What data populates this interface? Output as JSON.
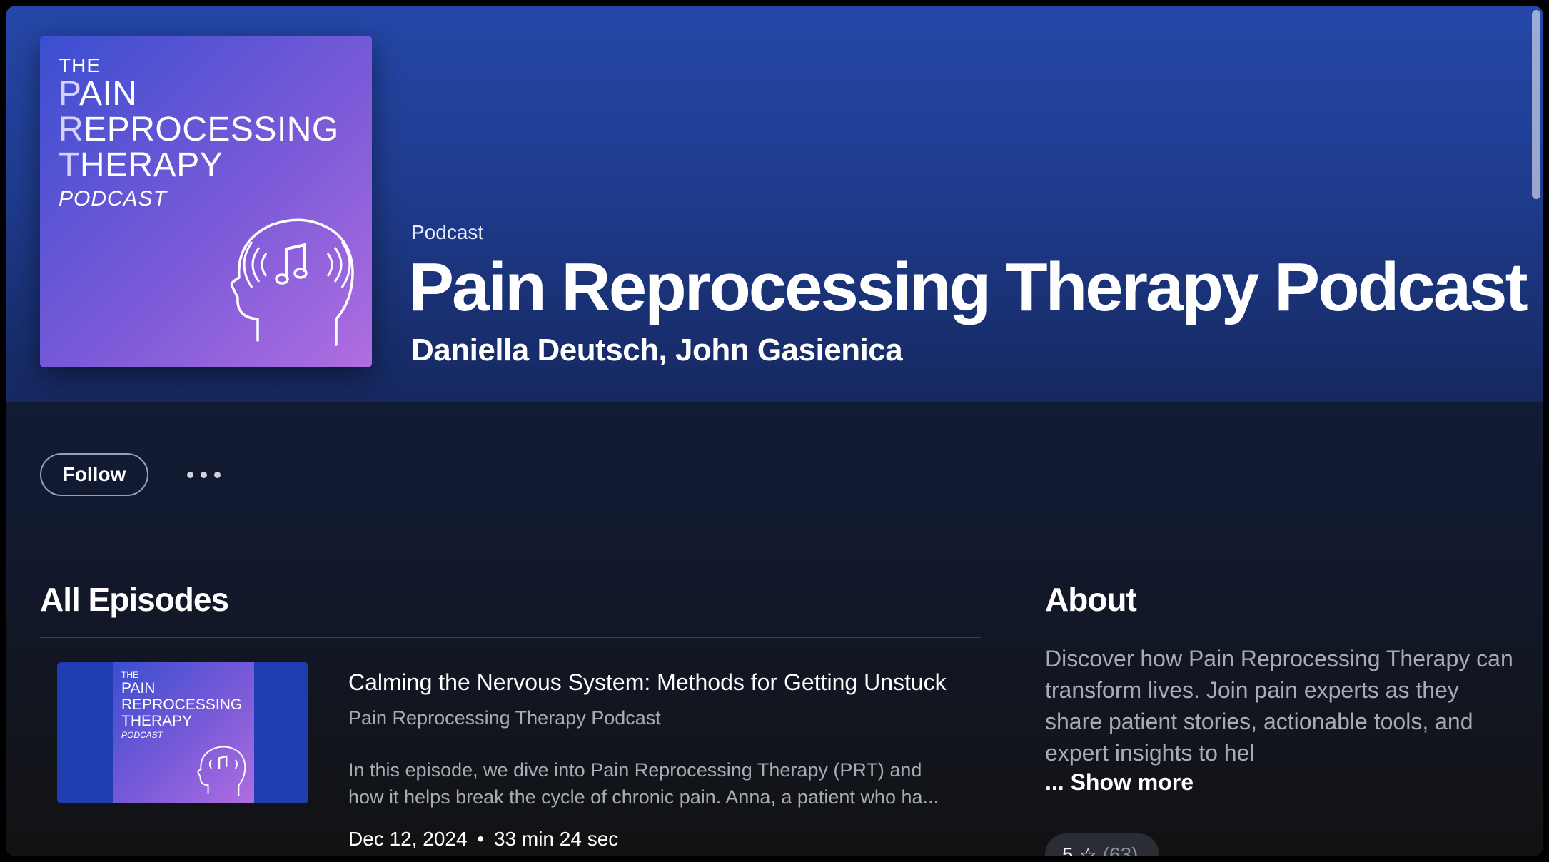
{
  "header": {
    "type_label": "Podcast",
    "title": "Pain Reprocessing Therapy Podcast",
    "authors": "Daniella Deutsch, John Gasienica"
  },
  "cover": {
    "line_the": "THE",
    "line_pain_first": "P",
    "line_pain_rest": "AIN",
    "line_reprocessing_first": "R",
    "line_reprocessing_rest": "EPROCESSING",
    "line_therapy_first": "T",
    "line_therapy_rest": "HERAPY",
    "line_podcast": "PODCAST"
  },
  "actions": {
    "follow_label": "Follow",
    "more_icon": "more-horizontal-icon"
  },
  "episodes": {
    "heading": "All Episodes",
    "items": [
      {
        "title": "Calming the Nervous System: Methods for Getting Unstuck",
        "show": "Pain Reprocessing Therapy Podcast",
        "description_line1": "In this episode, we dive into Pain Reprocessing Therapy (PRT) and",
        "description_line2": "how it helps break the cycle of chronic pain. Anna, a patient who ha...",
        "date": "Dec 12, 2024",
        "separator": "•",
        "duration": "33 min 24 sec",
        "thumb_the": "THE",
        "thumb_pain": "PAIN",
        "thumb_reprocessing": "REPROCESSING",
        "thumb_therapy": "THERAPY",
        "thumb_podcast": "PODCAST"
      }
    ]
  },
  "about": {
    "heading": "About",
    "line1": "Discover how Pain Reprocessing Therapy can",
    "line2": "transform lives. Join pain experts as they",
    "line3": "share patient stories, actionable tools, and",
    "line4": "expert insights to hel",
    "show_more": "... Show more",
    "rating_value": "5",
    "rating_icon": "star-icon",
    "rating_count": "(63)"
  }
}
